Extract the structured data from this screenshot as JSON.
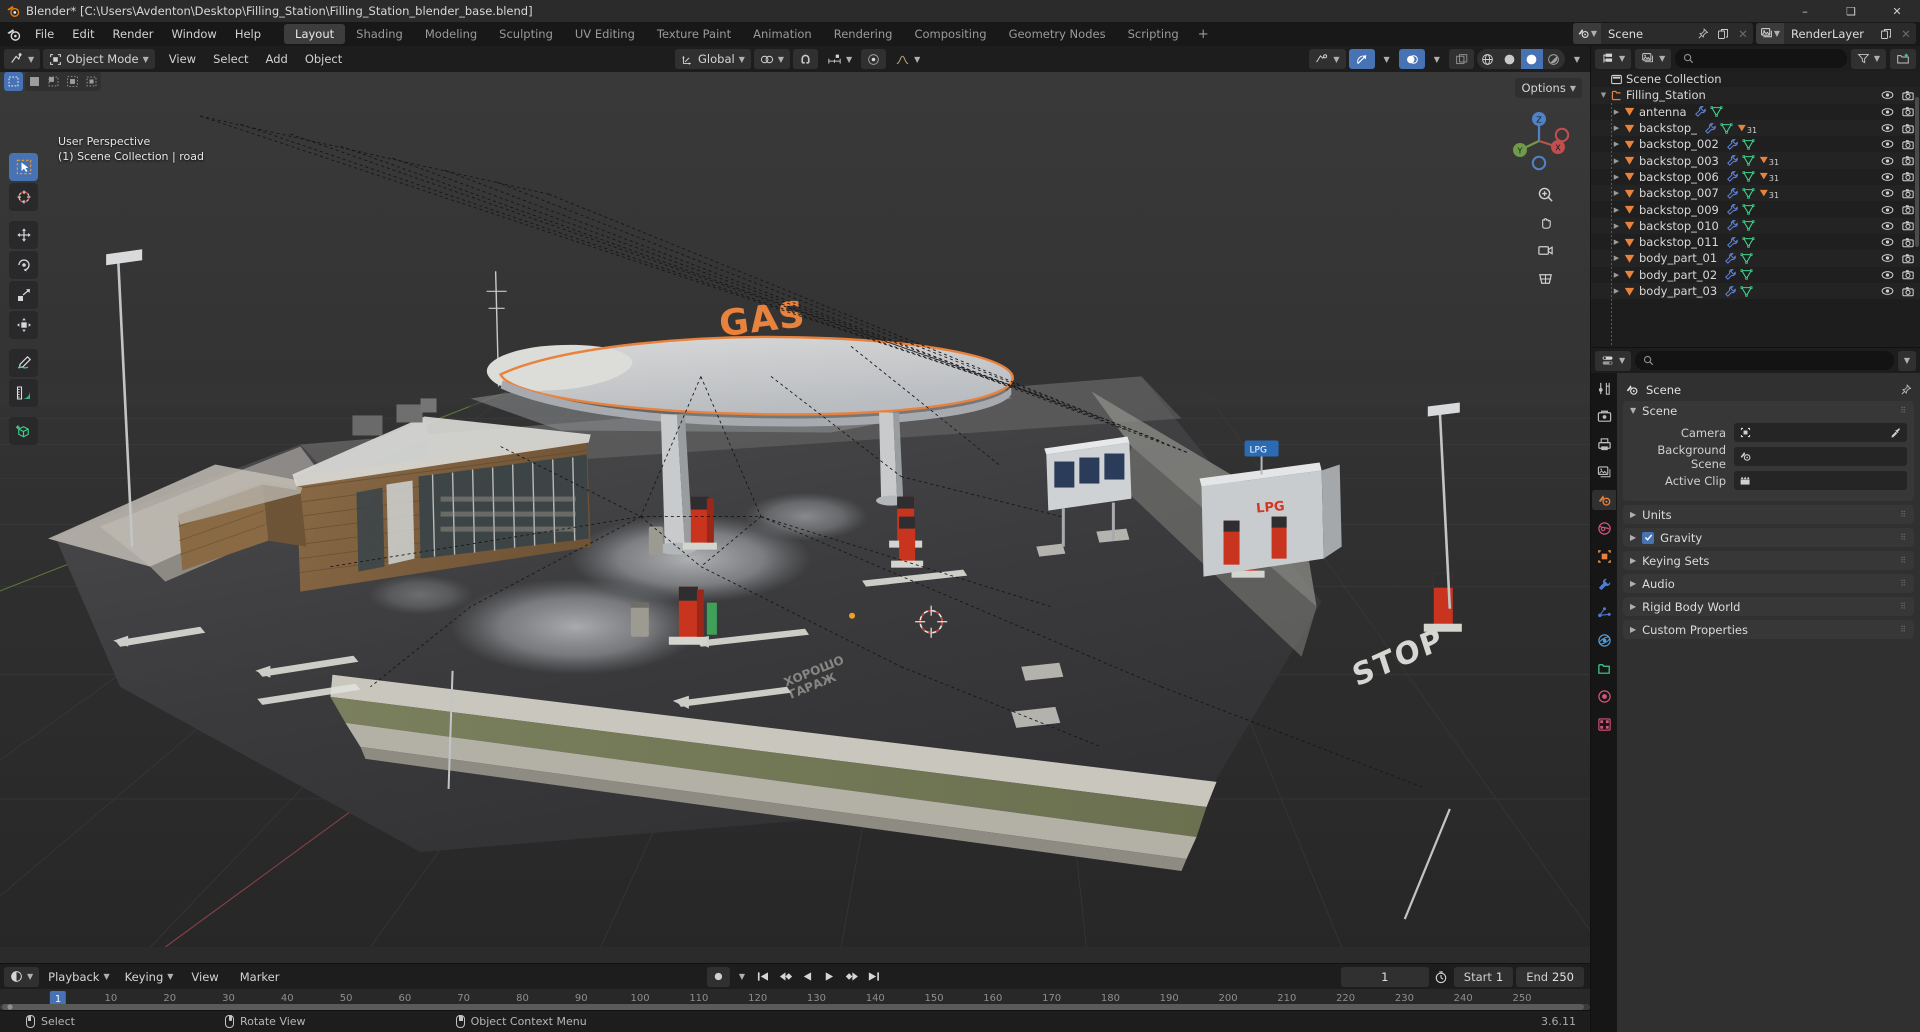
{
  "window": {
    "title": "Blender* [C:\\Users\\Avdenton\\Desktop\\Filling_Station\\Filling_Station_blender_base.blend]",
    "minimize": "–",
    "maximize": "❑",
    "close": "✕"
  },
  "topbar": {
    "menus": [
      "File",
      "Edit",
      "Render",
      "Window",
      "Help"
    ],
    "workspaces": [
      {
        "label": "Layout",
        "active": true
      },
      {
        "label": "Shading",
        "active": false
      },
      {
        "label": "Modeling",
        "active": false
      },
      {
        "label": "Sculpting",
        "active": false
      },
      {
        "label": "UV Editing",
        "active": false
      },
      {
        "label": "Texture Paint",
        "active": false
      },
      {
        "label": "Animation",
        "active": false
      },
      {
        "label": "Rendering",
        "active": false
      },
      {
        "label": "Compositing",
        "active": false
      },
      {
        "label": "Geometry Nodes",
        "active": false
      },
      {
        "label": "Scripting",
        "active": false
      }
    ],
    "add_workspace": "+",
    "scene_name": "Scene",
    "view_layer_name": "RenderLayer"
  },
  "viewport": {
    "mode": "Object Mode",
    "menus": [
      "View",
      "Select",
      "Add",
      "Object"
    ],
    "transform_orientation": "Global",
    "overlay_line1": "User Perspective",
    "overlay_line2": "(1) Scene Collection | road",
    "options_label": "Options",
    "gizmo_axes": {
      "x": "X",
      "y": "Y",
      "z": "Z"
    }
  },
  "outliner": {
    "search_placeholder": "",
    "root": "Scene Collection",
    "collection": "Filling_Station",
    "items": [
      {
        "name": "antenna",
        "modifier": true,
        "mesh": true,
        "data_count": null
      },
      {
        "name": "backstop_",
        "modifier": true,
        "mesh": true,
        "data_count": "31"
      },
      {
        "name": "backstop_002",
        "modifier": true,
        "mesh": true,
        "data_count": null
      },
      {
        "name": "backstop_003",
        "modifier": true,
        "mesh": true,
        "data_count": "31"
      },
      {
        "name": "backstop_006",
        "modifier": true,
        "mesh": true,
        "data_count": "31"
      },
      {
        "name": "backstop_007",
        "modifier": true,
        "mesh": true,
        "data_count": "31"
      },
      {
        "name": "backstop_009",
        "modifier": true,
        "mesh": true,
        "data_count": null
      },
      {
        "name": "backstop_010",
        "modifier": true,
        "mesh": true,
        "data_count": null
      },
      {
        "name": "backstop_011",
        "modifier": true,
        "mesh": true,
        "data_count": null
      },
      {
        "name": "body_part_01",
        "modifier": true,
        "mesh": true,
        "data_count": null
      },
      {
        "name": "body_part_02",
        "modifier": true,
        "mesh": true,
        "data_count": null
      },
      {
        "name": "body_part_03",
        "modifier": true,
        "mesh": true,
        "data_count": null
      }
    ]
  },
  "properties": {
    "search_placeholder": "",
    "breadcrumb": "Scene",
    "panels": [
      {
        "label": "Scene",
        "open": true,
        "checkbox": false
      },
      {
        "label": "Units",
        "open": false,
        "checkbox": false
      },
      {
        "label": "Gravity",
        "open": false,
        "checkbox": true
      },
      {
        "label": "Keying Sets",
        "open": false,
        "checkbox": false
      },
      {
        "label": "Audio",
        "open": false,
        "checkbox": false
      },
      {
        "label": "Rigid Body World",
        "open": false,
        "checkbox": false
      },
      {
        "label": "Custom Properties",
        "open": false,
        "checkbox": false
      }
    ],
    "scene_fields": [
      {
        "label": "Camera",
        "value": "",
        "eyedropper": true
      },
      {
        "label": "Background Scene",
        "value": "",
        "eyedropper": false
      },
      {
        "label": "Active Clip",
        "value": "",
        "eyedropper": false
      }
    ]
  },
  "timeline": {
    "menus": [
      "Playback",
      "Keying",
      "View",
      "Marker"
    ],
    "current_frame": "1",
    "start_label": "Start",
    "start_value": "1",
    "end_label": "End",
    "end_value": "250",
    "ticks": [
      "1",
      "10",
      "20",
      "30",
      "40",
      "50",
      "60",
      "70",
      "80",
      "90",
      "100",
      "110",
      "120",
      "130",
      "140",
      "150",
      "160",
      "170",
      "180",
      "190",
      "200",
      "210",
      "220",
      "230",
      "240",
      "250"
    ],
    "playhead": "1"
  },
  "status": {
    "hints": [
      {
        "button": "left",
        "label": "Select"
      },
      {
        "button": "middle",
        "label": "Rotate View"
      },
      {
        "button": "right",
        "label": "Object Context Menu"
      }
    ],
    "version": "3.6.11"
  },
  "colors": {
    "accent": "#4772b3",
    "orange": "#e8823c",
    "mesh_green": "#3fd18b",
    "modifier_blue": "#5d7fd3",
    "title_bg": "#2b2b2b",
    "panel_bg": "#303030",
    "editor_bg": "#1d1d1d"
  }
}
